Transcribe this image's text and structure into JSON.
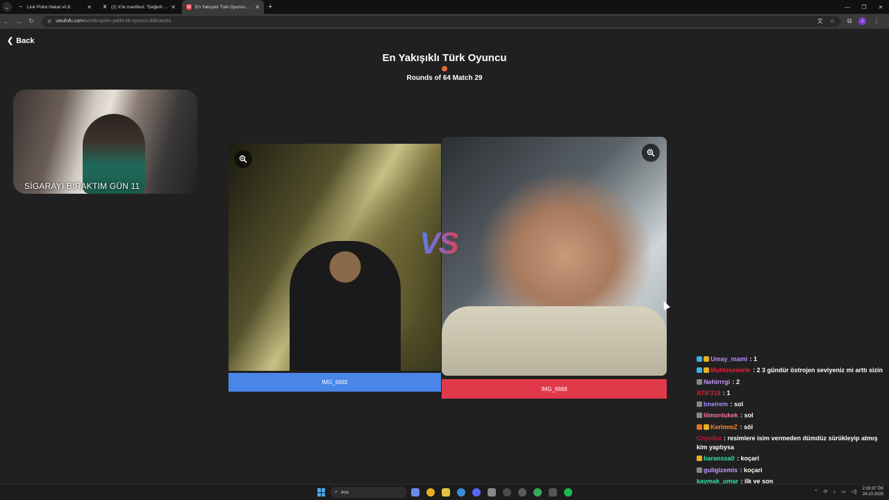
{
  "browser": {
    "tabs": [
      {
        "label": "Link Polisi Hakat v0.8",
        "favicon": "~",
        "active": false
      },
      {
        "label": "(2) X'te manifest: \"Değerli üyem",
        "favicon": "X",
        "active": false
      },
      {
        "label": "En Yakışıklı Türk Oyuncu | UwUf",
        "favicon": "U",
        "active": true
      }
    ],
    "url_host": "uwufufu.com",
    "url_path": "/worldcup/en-yakkl-trk-oyuncu-ddkrambo",
    "profile_initial": "c"
  },
  "page": {
    "back_label": "Back",
    "title": "En Yakışıklı Türk Oyuncu",
    "subtitle": "Rounds of 64 Match 29",
    "vs_text": "VS",
    "left_option": "IMG_6692",
    "right_option": "IMG_6688"
  },
  "webcam": {
    "overlay_text": "SİGARAYI BIRAKTIM GÜN 11"
  },
  "chat": [
    {
      "user": "Umay_mami",
      "text": "1",
      "color": "#b58bff",
      "badges": [
        "#3ab0e8",
        "#e8b020"
      ]
    },
    {
      "user": "Muhtesemefe",
      "text": "2 3 gündür östrojen seviyeniz mi arttı sizin",
      "color": "#d8263a",
      "badges": [
        "#3ab0e8",
        "#e8b020"
      ]
    },
    {
      "user": "Nehirrrgi",
      "text": "2",
      "color": "#c79bff",
      "badges": [
        "#888888"
      ]
    },
    {
      "user": "ATIF318",
      "text": "1",
      "color": "#d0243a",
      "badges": []
    },
    {
      "user": "bneirem",
      "text": "sol",
      "color": "#a78bff",
      "badges": [
        "#888888"
      ]
    },
    {
      "user": "liimonlukek",
      "text": "sol",
      "color": "#ff6fa0",
      "badges": [
        "#888888"
      ]
    },
    {
      "user": "KerimmZ",
      "text": "söl",
      "color": "#ff8a2a",
      "badges": [
        "#e87020",
        "#e8b020"
      ]
    },
    {
      "user": "Cnpolka",
      "text": "resimlere isim vermeden dümdüz sürükleyip atmış kim yaptıysa",
      "color": "#c8102e",
      "badges": []
    },
    {
      "user": "baranssa0",
      "text": "koçari",
      "color": "#2ee8a0",
      "badges": [
        "#e8b020"
      ]
    },
    {
      "user": "guligizemis",
      "text": "koçari",
      "color": "#c79bff",
      "badges": [
        "#888888"
      ]
    },
    {
      "user": "kaymak_umar",
      "text": "ilk ve son",
      "color": "#2ee8a0",
      "badges": []
    }
  ],
  "taskbar": {
    "search_placeholder": "Ara",
    "time": "2:33:37 ÖS",
    "date": "24.10.2025"
  }
}
